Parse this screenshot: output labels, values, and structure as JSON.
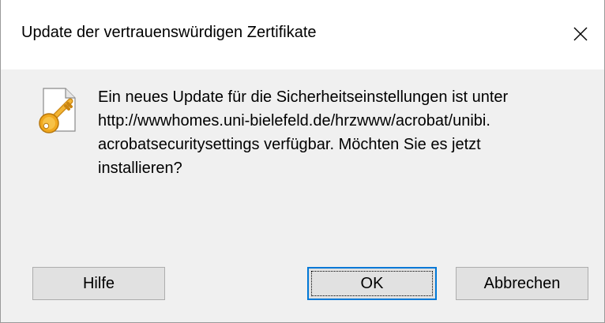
{
  "window": {
    "title": "Update der vertrauenswürdigen Zertifikate",
    "close_icon": "close-icon"
  },
  "message": {
    "icon": "certificate-key-icon",
    "lines": [
      "Ein neues Update für die Sicherheitseinstellungen ist unter",
      "http://wwwhomes.uni-bielefeld.de/hrzwww/acrobat/unibi.",
      "acrobatsecuritysettings verfügbar. Möchten Sie es jetzt",
      "installieren?"
    ]
  },
  "buttons": {
    "help_label": "Hilfe",
    "ok_label": "OK",
    "cancel_label": "Abbrechen",
    "default": "OK"
  },
  "colors": {
    "focus_border": "#0078d7",
    "dialog_background": "#f0f0f0",
    "button_face": "#e1e1e1",
    "key_gold": "#e8a21b"
  }
}
